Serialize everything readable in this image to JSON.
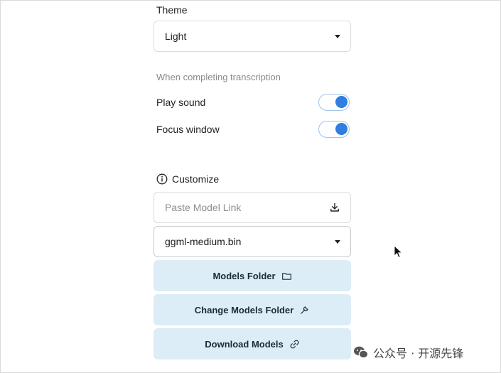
{
  "theme": {
    "label": "Theme",
    "selected": "Light"
  },
  "completion": {
    "section_label": "When completing transcription",
    "toggles": [
      {
        "label": "Play sound",
        "on": true
      },
      {
        "label": "Focus window",
        "on": true
      }
    ]
  },
  "customize": {
    "label": "Customize",
    "model_link_placeholder": "Paste Model Link",
    "model_selected": "ggml-medium.bin"
  },
  "buttons": {
    "models_folder": "Models Folder",
    "change_models_folder": "Change Models Folder",
    "download_models": "Download Models"
  },
  "watermark": {
    "text": "公众号 · 开源先锋"
  },
  "colors": {
    "accent": "#2f7ee0",
    "button_bg": "#dcedf8"
  }
}
